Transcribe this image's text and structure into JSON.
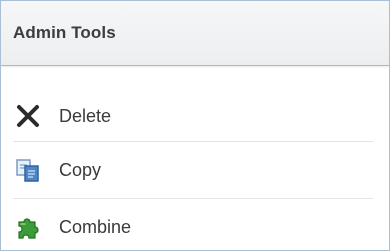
{
  "panel": {
    "title": "Admin Tools",
    "items": [
      {
        "label": "Delete",
        "icon": "x-icon"
      },
      {
        "label": "Copy",
        "icon": "copy-icon"
      },
      {
        "label": "Combine",
        "icon": "puzzle-icon"
      }
    ]
  },
  "colors": {
    "border": "#a9bfd6",
    "header_bg": "#f1f2f3",
    "text": "#3a3a3a",
    "copy_icon": "#4f86c6",
    "combine_icon": "#3c9c3a"
  }
}
